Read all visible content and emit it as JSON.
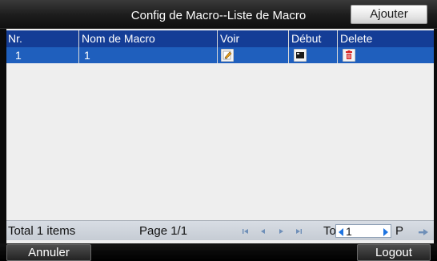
{
  "header": {
    "title": "Config de Macro--Liste de Macro",
    "add_button": "Ajouter"
  },
  "table": {
    "columns": [
      "Nr.",
      "Nom de Macro",
      "Voir",
      "Début",
      "Delete"
    ],
    "rows": [
      {
        "nr": "1",
        "name": "1",
        "view_icon": "edit-icon",
        "start_icon": "play-icon",
        "delete_icon": "trash-icon"
      }
    ]
  },
  "footer": {
    "total": "Total 1 items",
    "page": "Page 1/1",
    "to_label": "To",
    "page_input_value": "1",
    "p_label": "P",
    "nav_icons": [
      "first-page-icon",
      "prev-page-icon",
      "next-page-icon",
      "last-page-icon",
      "go-arrow-icon"
    ]
  },
  "bottom": {
    "cancel_button": "Annuler",
    "logout_button": "Logout"
  },
  "colors": {
    "header_row": "#143d96",
    "selected_row": "#1f5fbd",
    "content_bg": "#eeeeee",
    "frame": "#0b0b0b"
  }
}
